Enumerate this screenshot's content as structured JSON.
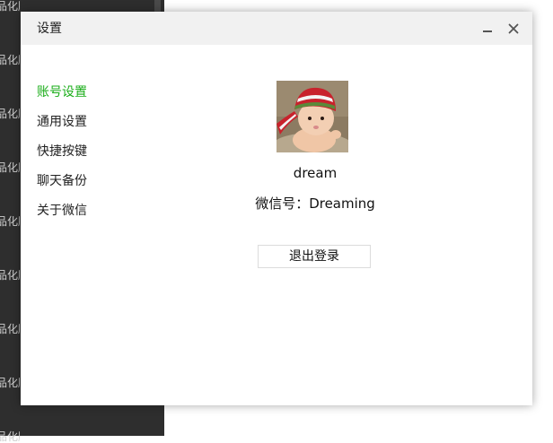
{
  "background": {
    "sidebar_text": [
      "品化膳",
      "品化膳",
      "品化膳",
      "品化膳",
      "品化膳",
      "品化膳",
      "品化膳",
      "品化膳",
      "品化膳"
    ]
  },
  "window": {
    "title": "设置"
  },
  "menu": {
    "items": [
      {
        "label": "账号设置",
        "active": true
      },
      {
        "label": "通用设置",
        "active": false
      },
      {
        "label": "快捷按键",
        "active": false
      },
      {
        "label": "聊天备份",
        "active": false
      },
      {
        "label": "关于微信",
        "active": false
      }
    ]
  },
  "profile": {
    "nickname": "dream",
    "wechat_id_text": "微信号：Dreaming",
    "logout_label": "退出登录"
  },
  "colors": {
    "accent": "#1aad19",
    "titlebar": "#f1f1f1",
    "background_dark": "#2e2e2e"
  }
}
